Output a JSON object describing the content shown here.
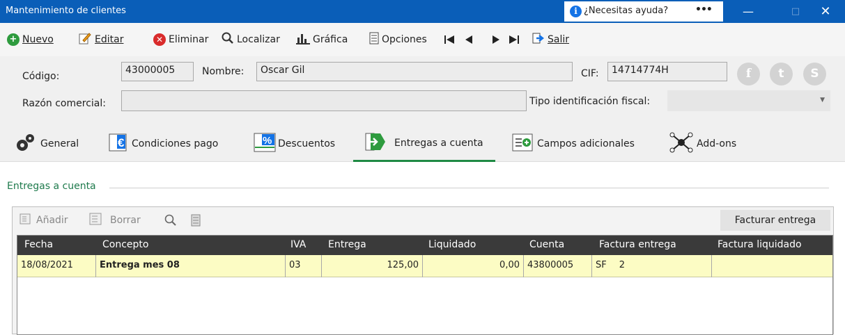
{
  "window": {
    "title": "Mantenimiento de clientes",
    "help_text": "¿Necesitas ayuda?",
    "help_dots": "•••"
  },
  "toolbar": {
    "nuevo": "Nuevo",
    "editar": "Editar",
    "eliminar": "Eliminar",
    "localizar": "Localizar",
    "grafica": "Gráfica",
    "opciones": "Opciones",
    "salir": "Salir"
  },
  "header": {
    "codigo_label": "Código:",
    "codigo_value": "43000005",
    "nombre_label": "Nombre:",
    "nombre_value": "Oscar Gil",
    "cif_label": "CIF:",
    "cif_value": "14714774H",
    "razon_label": "Razón comercial:",
    "razon_value": "",
    "tipo_label": "Tipo identificación fiscal:",
    "tipo_value": ""
  },
  "tabs": [
    {
      "label": "General"
    },
    {
      "label": "Condiciones pago"
    },
    {
      "label": "Descuentos"
    },
    {
      "label": "Entregas a cuenta"
    },
    {
      "label": "Campos adicionales"
    },
    {
      "label": "Add-ons"
    }
  ],
  "section": {
    "title": "Entregas a cuenta"
  },
  "panel": {
    "add_label": "Añadir",
    "delete_label": "Borrar",
    "invoice_button": "Facturar entrega"
  },
  "grid": {
    "columns": [
      "Fecha",
      "Concepto",
      "IVA",
      "Entrega",
      "Liquidado",
      "Cuenta",
      "Factura entrega",
      "Factura liquidado"
    ],
    "rows": [
      {
        "fecha": "18/08/2021",
        "concepto": "Entrega mes 08",
        "iva": "03",
        "entrega": "125,00",
        "liquidado": "0,00",
        "cuenta": "43800005",
        "factura_serie": "SF",
        "factura_num": "2",
        "factura_liq": ""
      }
    ]
  },
  "colors": {
    "titlebar": "#0a5eb8",
    "active_tab": "#1f8a44",
    "row_highlight": "#fcfcc4",
    "grid_header": "#3a3a3a"
  }
}
